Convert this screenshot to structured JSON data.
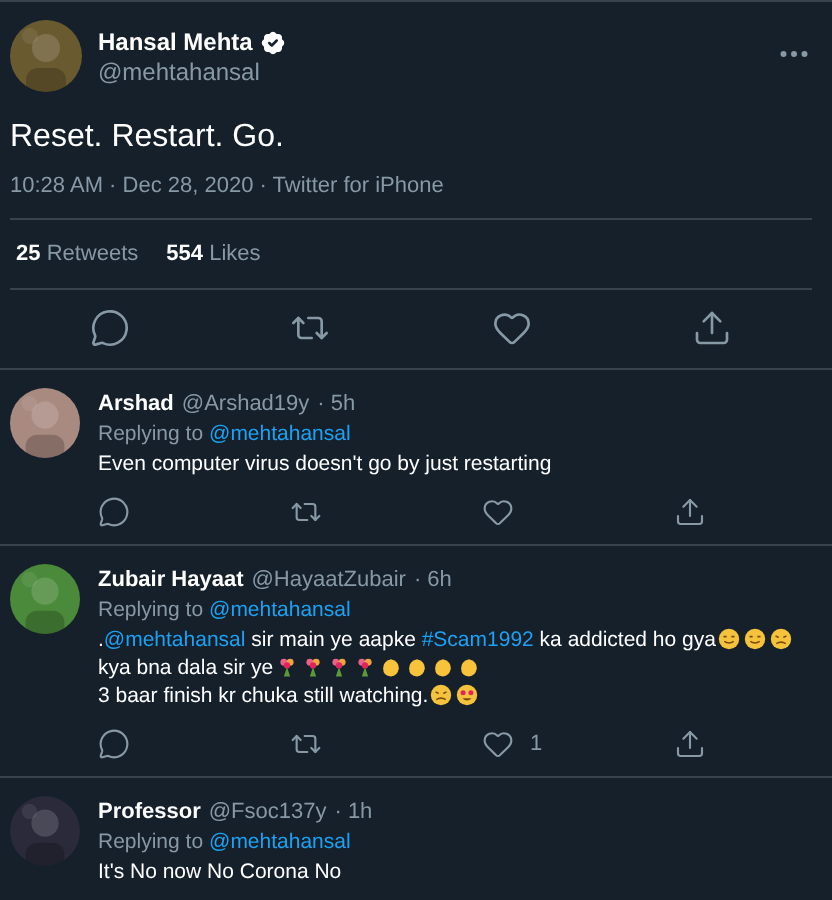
{
  "tweet": {
    "name": "Hansal Mehta",
    "verified": true,
    "handle": "@mehtahansal",
    "text": "Reset. Restart. Go.",
    "meta": "10:28 AM · Dec 28, 2020 · Twitter for iPhone",
    "stats": [
      {
        "count": "25",
        "label": "Retweets"
      },
      {
        "count": "554",
        "label": "Likes"
      }
    ]
  },
  "replies": [
    {
      "name": "Arshad",
      "handle": "@Arshad19y",
      "time": "· 5h",
      "replying_label": "Replying to",
      "replying_to": "@mehtahansal",
      "lines": [
        [
          {
            "kind": "text",
            "text": "Even computer virus doesn't go by just restarting"
          }
        ]
      ]
    },
    {
      "name": "Zubair Hayaat",
      "handle": "@HayaatZubair",
      "time": "· 6h",
      "replying_label": "Replying to",
      "replying_to": "@mehtahansal",
      "lines": [
        [
          {
            "kind": "text",
            "text": "."
          },
          {
            "kind": "link",
            "text": "@mehtahansal"
          },
          {
            "kind": "text",
            "text": " sir main ye aapke "
          },
          {
            "kind": "link",
            "text": "#Scam1992"
          },
          {
            "kind": "text",
            "text": " ka addicted ho gya"
          },
          {
            "kind": "face"
          },
          {
            "kind": "face"
          },
          {
            "kind": "sad-face"
          }
        ],
        [
          {
            "kind": "text",
            "text": "kya bna dala sir ye"
          },
          {
            "kind": "bouquet"
          },
          {
            "kind": "bouquet"
          },
          {
            "kind": "bouquet"
          },
          {
            "kind": "bouquet"
          },
          {
            "kind": "clap"
          },
          {
            "kind": "clap"
          },
          {
            "kind": "clap"
          },
          {
            "kind": "clap"
          }
        ],
        [
          {
            "kind": "text",
            "text": "3 baar finish kr chuka still watching."
          },
          {
            "kind": "sad-face"
          },
          {
            "kind": "heart-eyes"
          }
        ]
      ],
      "likes": "1"
    },
    {
      "name": "Professor",
      "handle": "@Fsoc137y",
      "time": "· 1h",
      "replying_label": "Replying to",
      "replying_to": "@mehtahansal",
      "lines": [
        [
          {
            "kind": "text",
            "text": "It's No now No Corona No"
          }
        ]
      ]
    }
  ]
}
